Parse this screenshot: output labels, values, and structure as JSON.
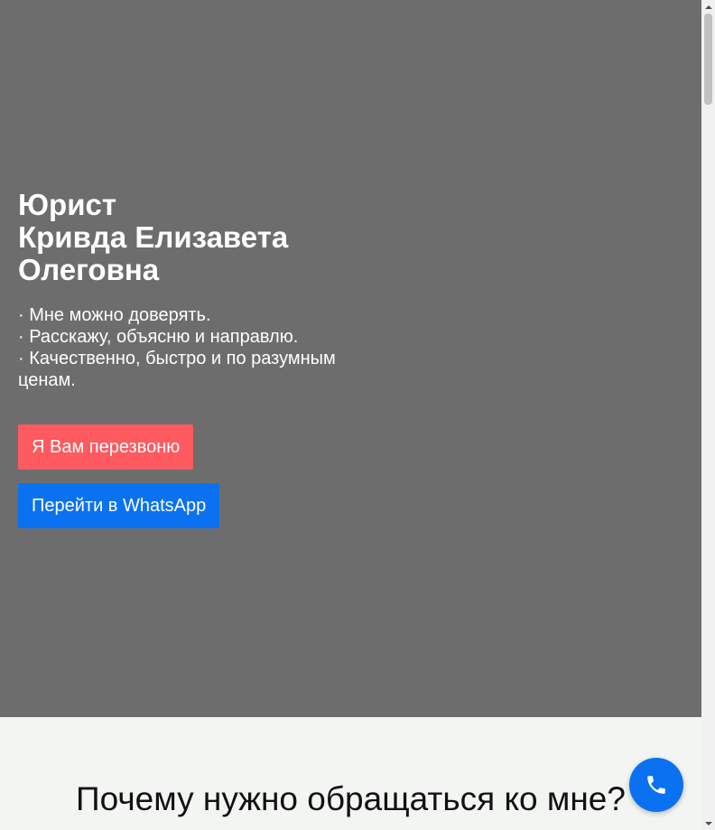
{
  "hero": {
    "title_lines": [
      "Юрист",
      "Кривда Елизавета",
      "Олеговна"
    ],
    "bullets": [
      "· Мне можно доверять.",
      "· Расскажу, объясню и направлю.",
      "· Качественно, быстро и по разумным ценам."
    ],
    "callback_button": "Я Вам перезвоню",
    "whatsapp_button": "Перейти в WhatsApp",
    "background_color": "#6d6d6d"
  },
  "why_section": {
    "title": "Почему нужно обращаться ко мне?"
  },
  "call_fab": {
    "icon": "phone-icon",
    "color": "#0a72f0"
  },
  "colors": {
    "callback": "#ff5a5f",
    "whatsapp": "#0a72f0",
    "section_bg": "#f3f5f3"
  },
  "scrollbar": {
    "up_icon": "arrow-up-icon",
    "down_icon": "arrow-down-icon"
  }
}
